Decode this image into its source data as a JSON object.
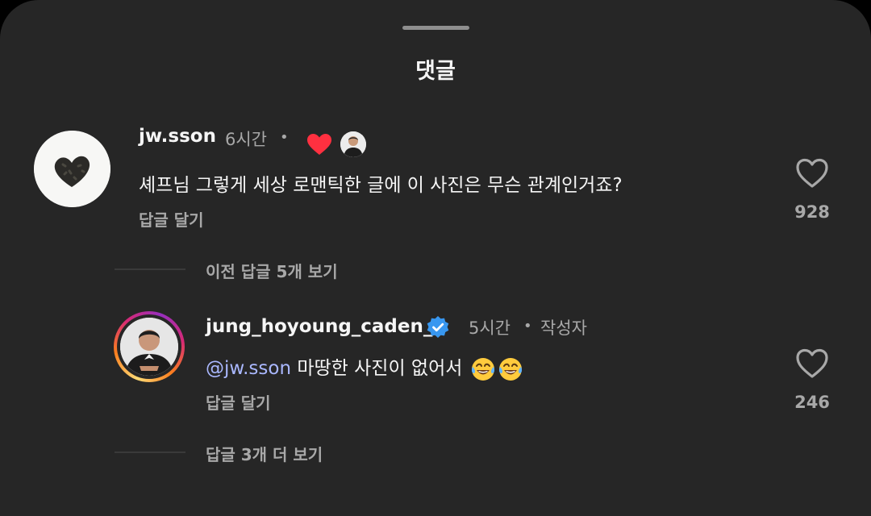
{
  "header": {
    "title": "댓글"
  },
  "comments": [
    {
      "username": "jw.sson",
      "time": "6시간",
      "separator": "•",
      "text": "셰프님 그렇게 세상 로맨틱한 글에 이 사진은 무슨 관계인거죠?",
      "reply_label": "답글 달기",
      "like_count": "928",
      "view_more": "이전 답글 5개 보기"
    },
    {
      "username": "jung_hoyoung_caden_",
      "time": "5시간",
      "separator": "•",
      "author_tag": "작성자",
      "mention": "@jw.sson",
      "text": " 마땅한 사진이 없어서 ",
      "reply_label": "답글 달기",
      "like_count": "246",
      "view_more": "답글 3개 더 보기"
    }
  ],
  "icons": {
    "liked_heart": "red-heart-icon",
    "like": "heart-outline-icon",
    "verified": "verified-badge-icon",
    "emoji": "tears-of-joy-emoji"
  },
  "colors": {
    "background": "#262626",
    "text": "#f5f5f5",
    "secondary": "#a8a8a8",
    "mention": "#aab8ff",
    "heart": "#ff3040",
    "verified": "#3897f0"
  }
}
